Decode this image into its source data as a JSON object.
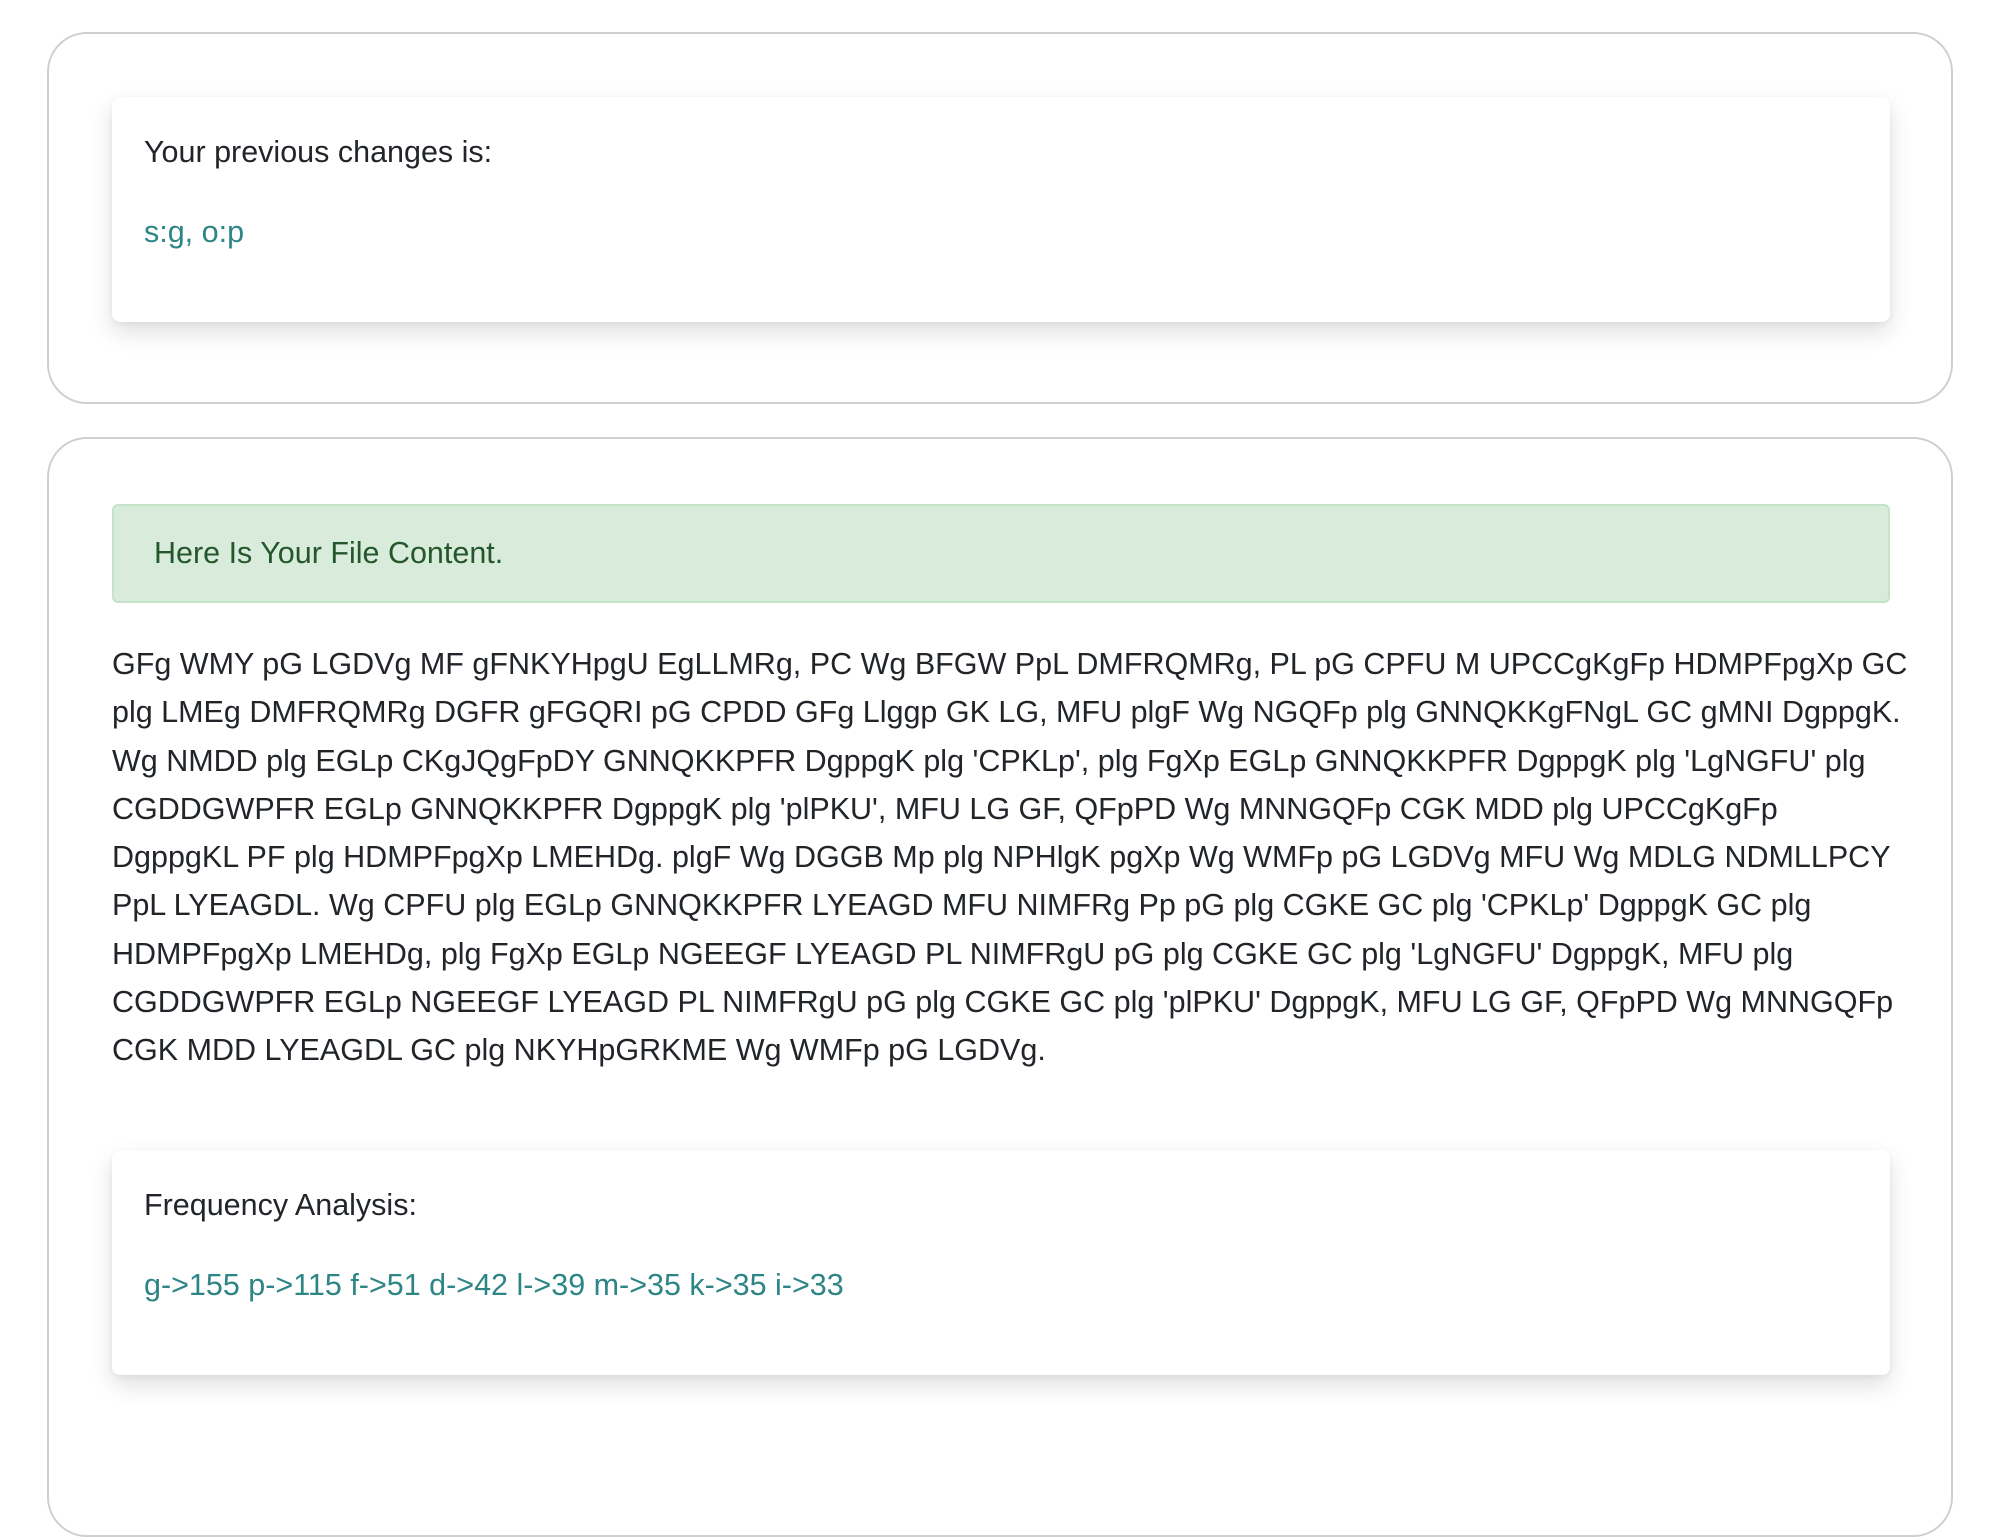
{
  "previous_changes": {
    "title": "Your previous changes is:",
    "value": "s:g, o:p"
  },
  "file_content": {
    "alert": "Here Is Your File Content.",
    "text": "GFg WMY pG LGDVg MF gFNKYHpgU EgLLMRg, PC Wg BFGW PpL DMFRQMRg, PL pG CPFU M UPCCgKgFp HDMPFpgXp GC plg LMEg DMFRQMRg DGFR gFGQRI pG CPDD GFg Llggp GK LG, MFU plgF Wg NGQFp plg GNNQKKgFNgL GC gMNI DgppgK. Wg NMDD plg EGLp CKgJQgFpDY GNNQKKPFR DgppgK plg 'CPKLp', plg FgXp EGLp GNNQKKPFR DgppgK plg 'LgNGFU' plg CGDDGWPFR EGLp GNNQKKPFR DgppgK plg 'plPKU', MFU LG GF, QFpPD Wg MNNGQFp CGK MDD plg UPCCgKgFp DgppgKL PF plg HDMPFpgXp LMEHDg. plgF Wg DGGB Mp plg NPHlgK pgXp Wg WMFp pG LGDVg MFU Wg MDLG NDMLLPCY PpL LYEAGDL. Wg CPFU plg EGLp GNNQKKPFR LYEAGD MFU NIMFRg Pp pG plg CGKE GC plg 'CPKLp' DgppgK GC plg HDMPFpgXp LMEHDg, plg FgXp EGLp NGEEGF LYEAGD PL NIMFRgU pG plg CGKE GC plg 'LgNGFU' DgppgK, MFU plg CGDDGWPFR EGLp NGEEGF LYEAGD PL NIMFRgU pG plg CGKE GC plg 'plPKU' DgppgK, MFU LG GF, QFpPD Wg MNNGQFp CGK MDD LYEAGDL GC plg NKYHpGRKME Wg WMFp pG LGDVg."
  },
  "frequency_analysis": {
    "title": "Frequency Analysis:",
    "value": "g->155 p->115 f->51 d->42 l->39 m->35 k->35 i->33"
  },
  "colors": {
    "accent_text": "#2e8585",
    "alert_bg": "#d9ebdb",
    "alert_text": "#24572b"
  }
}
